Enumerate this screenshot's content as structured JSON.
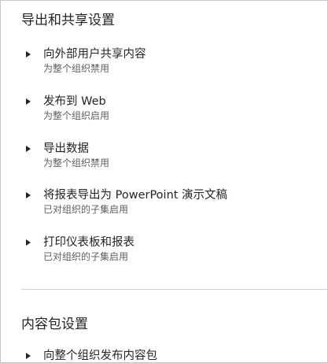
{
  "export_section": {
    "title": "导出和共享设置",
    "items": [
      {
        "name": "向外部用户共享内容",
        "status": "为整个组织禁用"
      },
      {
        "name": "发布到 Web",
        "status": "为整个组织启用"
      },
      {
        "name": "导出数据",
        "status": "为整个组织禁用"
      },
      {
        "name": "将报表导出为 PowerPoint 演示文稿",
        "status": "已对组织的子集启用"
      },
      {
        "name": "打印仪表板和报表",
        "status": "已对组织的子集启用"
      }
    ]
  },
  "content_pack_section": {
    "title": "内容包设置",
    "items": [
      {
        "name": "向整个组织发布内容包"
      }
    ]
  },
  "icons": {
    "expand": "chevron-right-icon"
  },
  "colors": {
    "text_primary": "#252423",
    "text_secondary": "#605e5c",
    "divider": "#d2d0ce",
    "border": "#c8c8c8"
  }
}
